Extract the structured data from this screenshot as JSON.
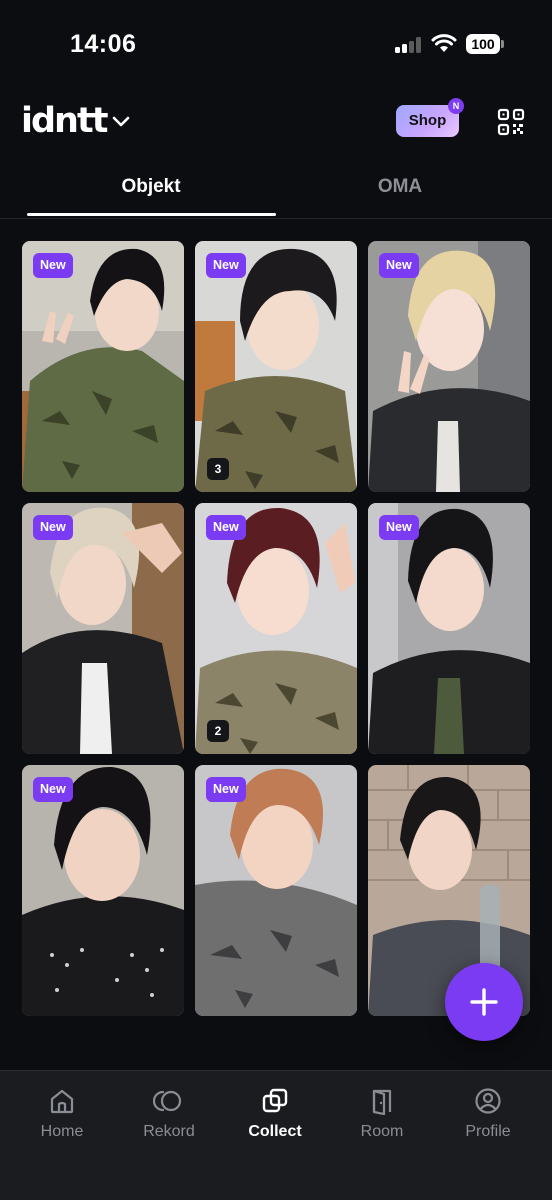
{
  "status_bar": {
    "time": "14:06",
    "battery": "100"
  },
  "header": {
    "logo": "idntt",
    "shop_label": "Shop",
    "shop_badge": "N"
  },
  "tabs": [
    {
      "label": "Objekt",
      "active": true
    },
    {
      "label": "OMA",
      "active": false
    }
  ],
  "cards": [
    {
      "badge": "New",
      "count": null
    },
    {
      "badge": "New",
      "count": "3"
    },
    {
      "badge": "New",
      "count": null
    },
    {
      "badge": "New",
      "count": null
    },
    {
      "badge": "New",
      "count": "2"
    },
    {
      "badge": "New",
      "count": null
    },
    {
      "badge": "New",
      "count": null
    },
    {
      "badge": "New",
      "count": null
    },
    {
      "badge": null,
      "count": null
    }
  ],
  "bottom_nav": [
    {
      "label": "Home",
      "icon": "home-icon",
      "active": false
    },
    {
      "label": "Rekord",
      "icon": "rekord-icon",
      "active": false
    },
    {
      "label": "Collect",
      "icon": "collect-icon",
      "active": true
    },
    {
      "label": "Room",
      "icon": "door-icon",
      "active": false
    },
    {
      "label": "Profile",
      "icon": "profile-icon",
      "active": false
    }
  ],
  "colors": {
    "accent": "#7b3bf2",
    "background": "#0c0d10",
    "nav_background": "#1a1c20",
    "inactive_text": "#8a8d94"
  }
}
